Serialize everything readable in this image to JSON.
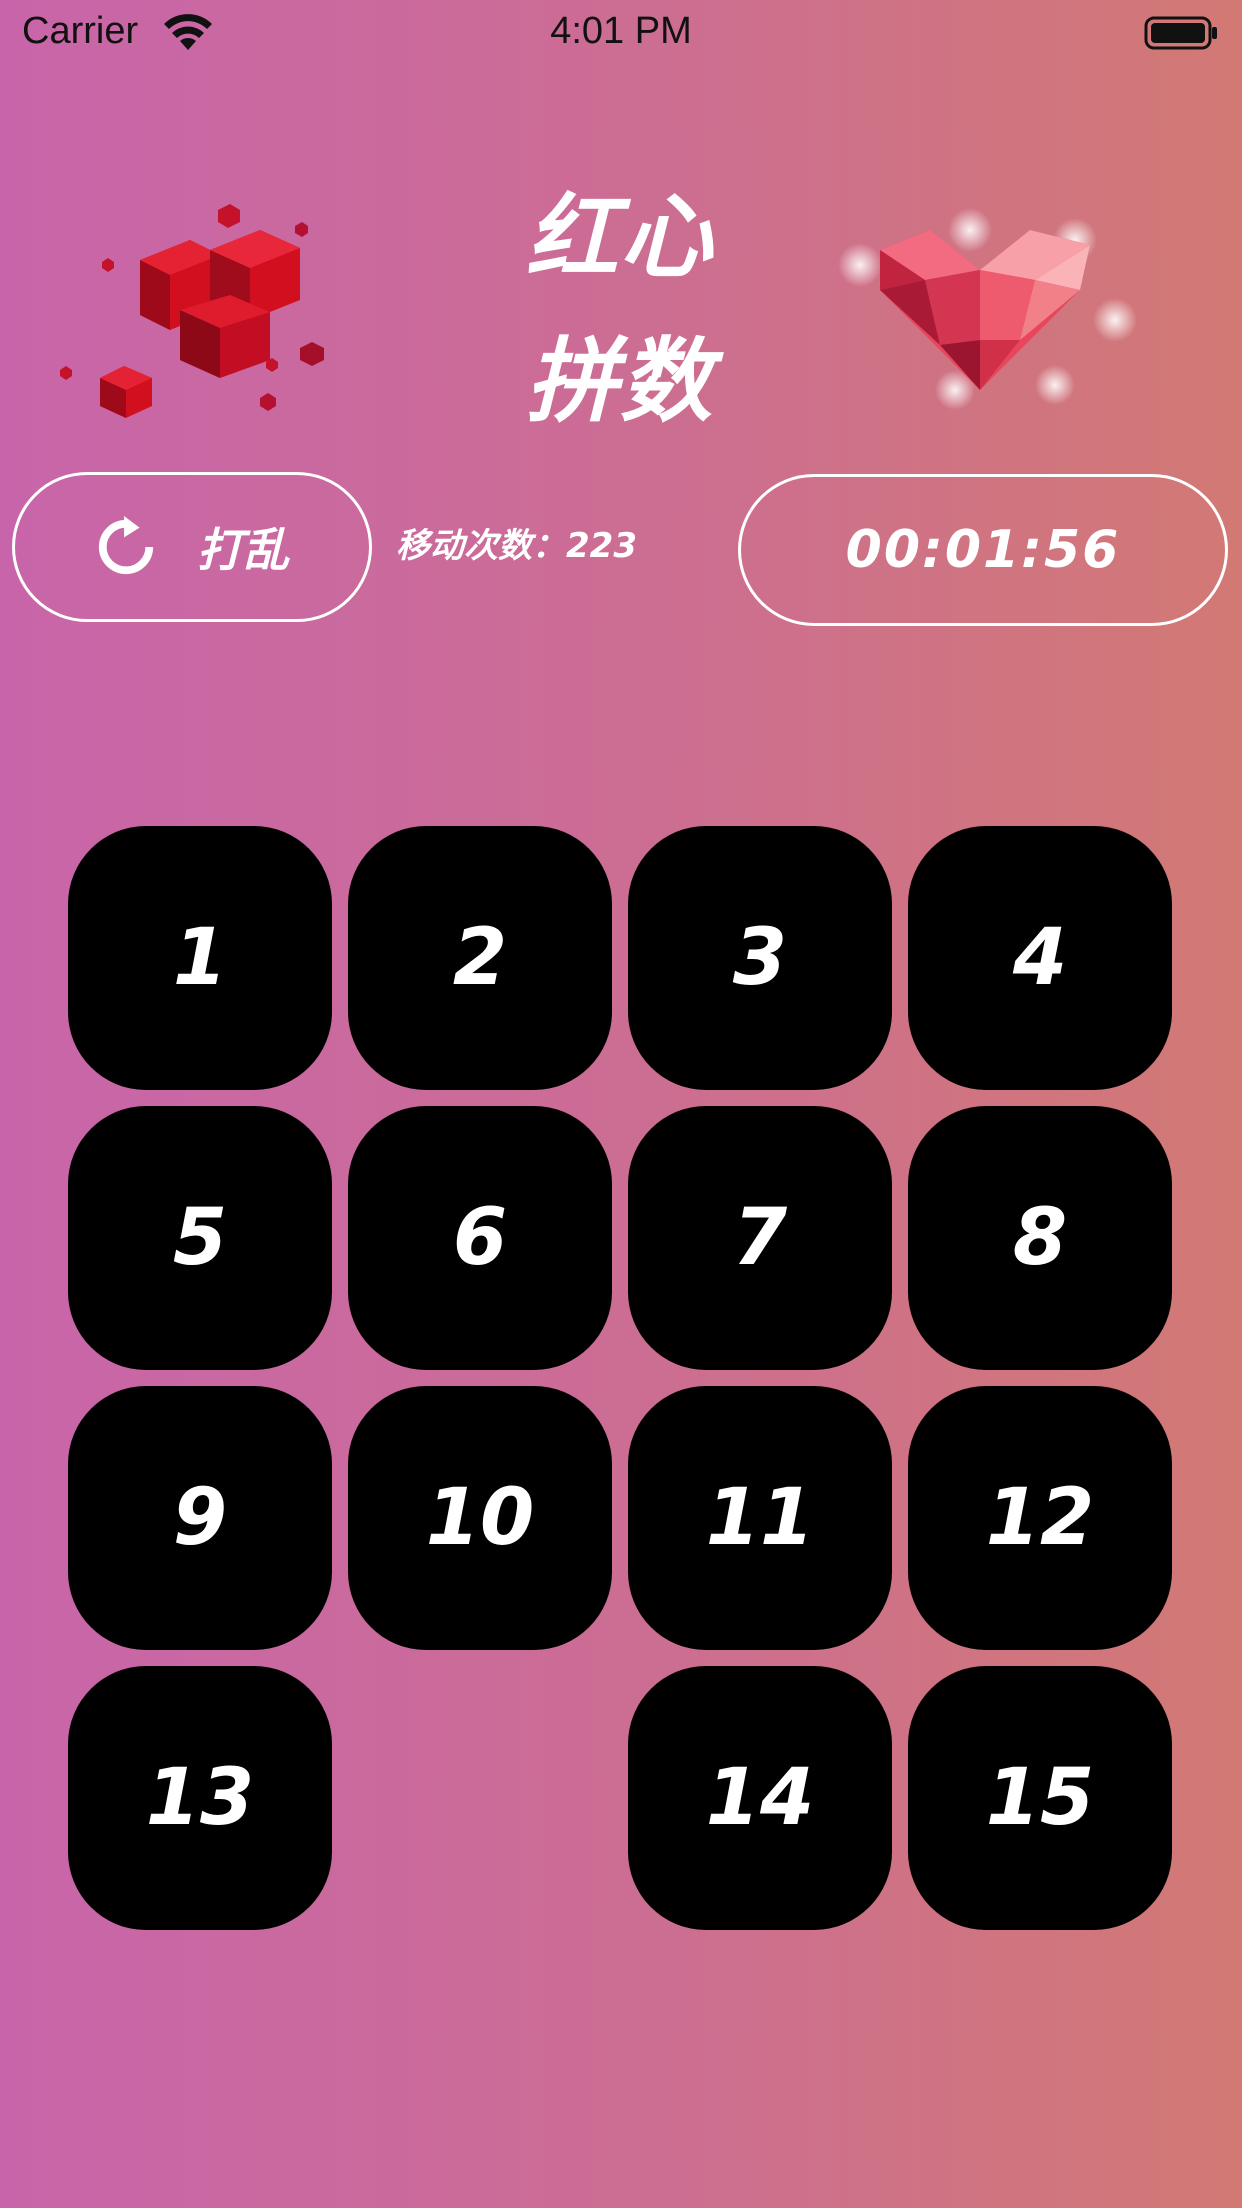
{
  "status_bar": {
    "carrier": "Carrier",
    "time": "4:01 PM"
  },
  "header": {
    "title_line1": "红心",
    "title_line2": "拼数",
    "left_art": "red-cubes-image",
    "right_art": "crystal-heart-image"
  },
  "controls": {
    "shuffle_label": "打乱",
    "move_count_text": "移动次数：223",
    "timer": "00:01:56"
  },
  "board": {
    "tiles": [
      "1",
      "2",
      "3",
      "4",
      "5",
      "6",
      "7",
      "8",
      "9",
      "10",
      "11",
      "12",
      "13",
      "",
      "14",
      "15"
    ],
    "empty_index": 13,
    "tile_color": "#000000",
    "text_color": "#ffffff"
  },
  "colors": {
    "gradient_left": "#c865aa",
    "gradient_right": "#d27974"
  }
}
